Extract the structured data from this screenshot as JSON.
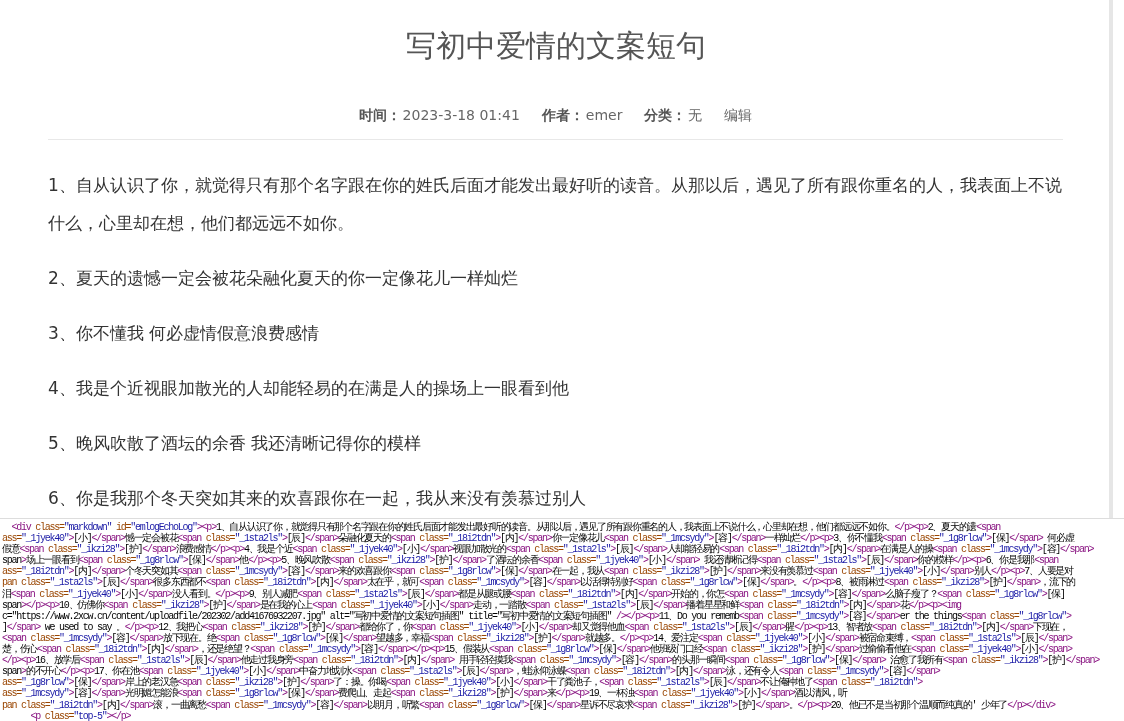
{
  "article": {
    "title": "写初中爱情的文案短句",
    "meta": [
      {
        "label": "时间：",
        "value": "2023-3-18 01:41"
      },
      {
        "label": "作者：",
        "value": "emer"
      },
      {
        "label": "分类：",
        "value": "无"
      }
    ],
    "edit_link": "编辑",
    "paragraphs": [
      "1、自从认识了你，就觉得只有那个名字跟在你的姓氏后面才能发出最好听的读音。从那以后，遇见了所有跟你重名的人，我表面上不说什么，心里却在想，他们都远远不如你。",
      "2、夏天的遗憾一定会被花朵融化夏天的你一定像花儿一样灿烂",
      "3、你不懂我 何必虚情假意浪费感情",
      "4、我是个近视眼加散光的人却能轻易的在满是人的操场上一眼看到他",
      "5、晚风吹散了酒坛的余香 我还清晰记得你的模样",
      "6、你是我那个冬天突如其来的欢喜跟你在一起，我从来没有羡慕过别人"
    ]
  },
  "source_view": {
    "lines": [
      "  <div class=\"markdown\" id=\"emlogEchoLog\"><p>1、自从认识了你，就觉得只有那个名字跟在你的姓氏后面才能发出最好听的读音。从那以后，遇见了所有跟你重名的人，我表面上不说什么，心里却在想，他们都远远不如你。</p><p>2、夏天的遗<span",
      "ass=\"_1jyek40\">[小]</span>憾一定会被花<span class=\"_1sta2ls\">[辰]</span>朵融化夏天的<span class=\"_18i2tdn\">[内]</span>你一定像花儿<span class=\"_1mcsydy\">[容]</span>一样灿烂</p><p>3、你不懂我<span class=\"_1g8rlcw\">[保]</span> 何必虚",
      "假意<span class=\"_ikzi28\">[护]</span>浪费感情</p><p>4、我是个近<span class=\"_1jyek40\">[小]</span>视眼加散光的<span class=\"_1sta2ls\">[辰]</span>人却能轻易的<span class=\"_18i2tdn\">[内]</span>在满是人的操<span class=\"_1mcsydy\">[容]</span>",
      "span>场上一眼看到<span class=\"_1g8rlcw\">[保]</span>他</p><p>5、晚风吹散<span class=\"_ikzi28\">[护]</span>了酒坛的余香<span class=\"_1jyek40\">[小]</span> 我还清晰记得<span class=\"_1sta2ls\">[辰]</span>你的模样</p><p>6、你是我那<span",
      "ass=\"_18i2tdn\">[内]</span>个冬天突如其<span class=\"_1mcsydy\">[容]</span>来的欢喜跟你<span class=\"_1g8rlcw\">[保]</span>在一起，我从<span class=\"_ikzi28\">[护]</span>来没有羡慕过<span class=\"_1jyek40\">[小]</span>别人</p><p>7、人要是对",
      "pan class=\"_1sta2ls\">[辰]</span>很多东西都不<span class=\"_18i2tdn\">[内]</span>太在乎，就可<span class=\"_1mcsydy\">[容]</span>以活得特别好<span class=\"_1g8rlcw\">[保]</span>。</p><p>8、被雨淋过<span class=\"_ikzi28\">[护]</span>，流下的",
      "泪<span class=\"_1jyek40\">[小]</span>没人看到。</p><p>9、别人减肥<span class=\"_1sta2ls\">[辰]</span>都是从腿或腰<span class=\"_18i2tdn\">[内]</span>开始的，你怎<span class=\"_1mcsydy\">[容]</span>么脑子瘦了？<span class=\"_1g8rlcw\">[保]",
      "span></p><p>10、仿佛你<span class=\"_ikzi28\">[护]</span>是在我的心上<span class=\"_1jyek40\">[小]</span>走动，一踏散<span class=\"_1sta2ls\">[辰]</span>播着星星和鲜<span class=\"_18i2tdn\">[内]</span>花</p><p><img",
      "c=\"https://www.2xcw.cn/content/uploadfile/202302/add41676932207.jpg\" alt=\"写初中爱情的文案短句插图\" title=\"写初中爱情的文案短句插图\" /></p><p>11、Do you rememb<span class=\"_1mcsydy\">[容]</span>er the things<span class=\"_1g8rlcw\">",
      "]</span> we used to say 。</p><p>12、我把心<span class=\"_ikzi28\">[护]</span>都给你了，你<span class=\"_1jyek40\">[小]</span>却又觉得他血<span class=\"_1sta2ls\">[辰]</span>腥</p><p>13、智者放<span class=\"_18i2tdn\">[内]</span>下现在，",
      "<span class=\"_1mcsydy\">[容]</span>放下现在。绝<span class=\"_1g8rlcw\">[保]</span>望越多，幸福<span class=\"_ikzi28\">[护]</span>就越多。</p><p>14、爱注定<span class=\"_1jyek40\">[小]</span>被宿命束缚，<span class=\"_1sta2ls\">[辰]</span>",
      "楚，伤心<span class=\"_18i2tdn\">[内]</span>，还是绝望？<span class=\"_1mcsydy\">[容]</span></p><p>15、假装从<span class=\"_1g8rlcw\">[保]</span>他班级门口经<span class=\"_ikzi28\">[护]</span>过偷偷看他在<span class=\"_1jyek40\">[小]</span>",
      "</p><p>16、放学后<span class=\"_1sta2ls\">[辰]</span>他走过我身旁<span class=\"_18i2tdn\">[内]</span> 用手轻轻摸我<span class=\"_1mcsydy\">[容]</span>的头那一瞬间<span class=\"_1g8rlcw\">[保]</span> 治愈了我所有<span class=\"_ikzi28\">[护]</span>",
      "span>的不开心</p><p>17、你在池<span class=\"_1jyek40\">[小]</span>中奋力地划水<span class=\"_1sta2ls\">[辰]</span>，蛙泳仰泳蝶<span class=\"_18i2tdn\">[内]</span>泳，还有令人<span class=\"_1mcsydy\">[容]</span>",
      "ass=\"_1g8rlcw\">[保]</span>岸上的老汉急<span class=\"_ikzi28\">[护]</span>了：操。你喝<span class=\"_1jyek40\">[小]</span>干了粪池子，<span class=\"_1sta2ls\">[辰]</span>不让俺种地了<span class=\"_18i2tdn\">",
      "ass=\"_1mcsydy\">[容]</span>光明媚怎能浪<span class=\"_1g8rlcw\">[保]</span>费爬山、走起<span class=\"_ikzi28\">[护]</span>来</p><p>19、一杯浊<span class=\"_1jyek40\">[小]</span>酒以清风，听",
      "pan class=\"_18i2tdn\">[内]</span>滚，一曲离愁<span class=\"_1mcsydy\">[容]</span>以明月，听繁<span class=\"_1g8rlcw\">[保]</span>星诉不尽哀求<span class=\"_ikzi28\">[护]</span>。</p><p>20、他已不是当初那个温顺而纯真的' 少年了</p></div>",
      "      <p class=\"top-5\"></p>"
    ]
  }
}
